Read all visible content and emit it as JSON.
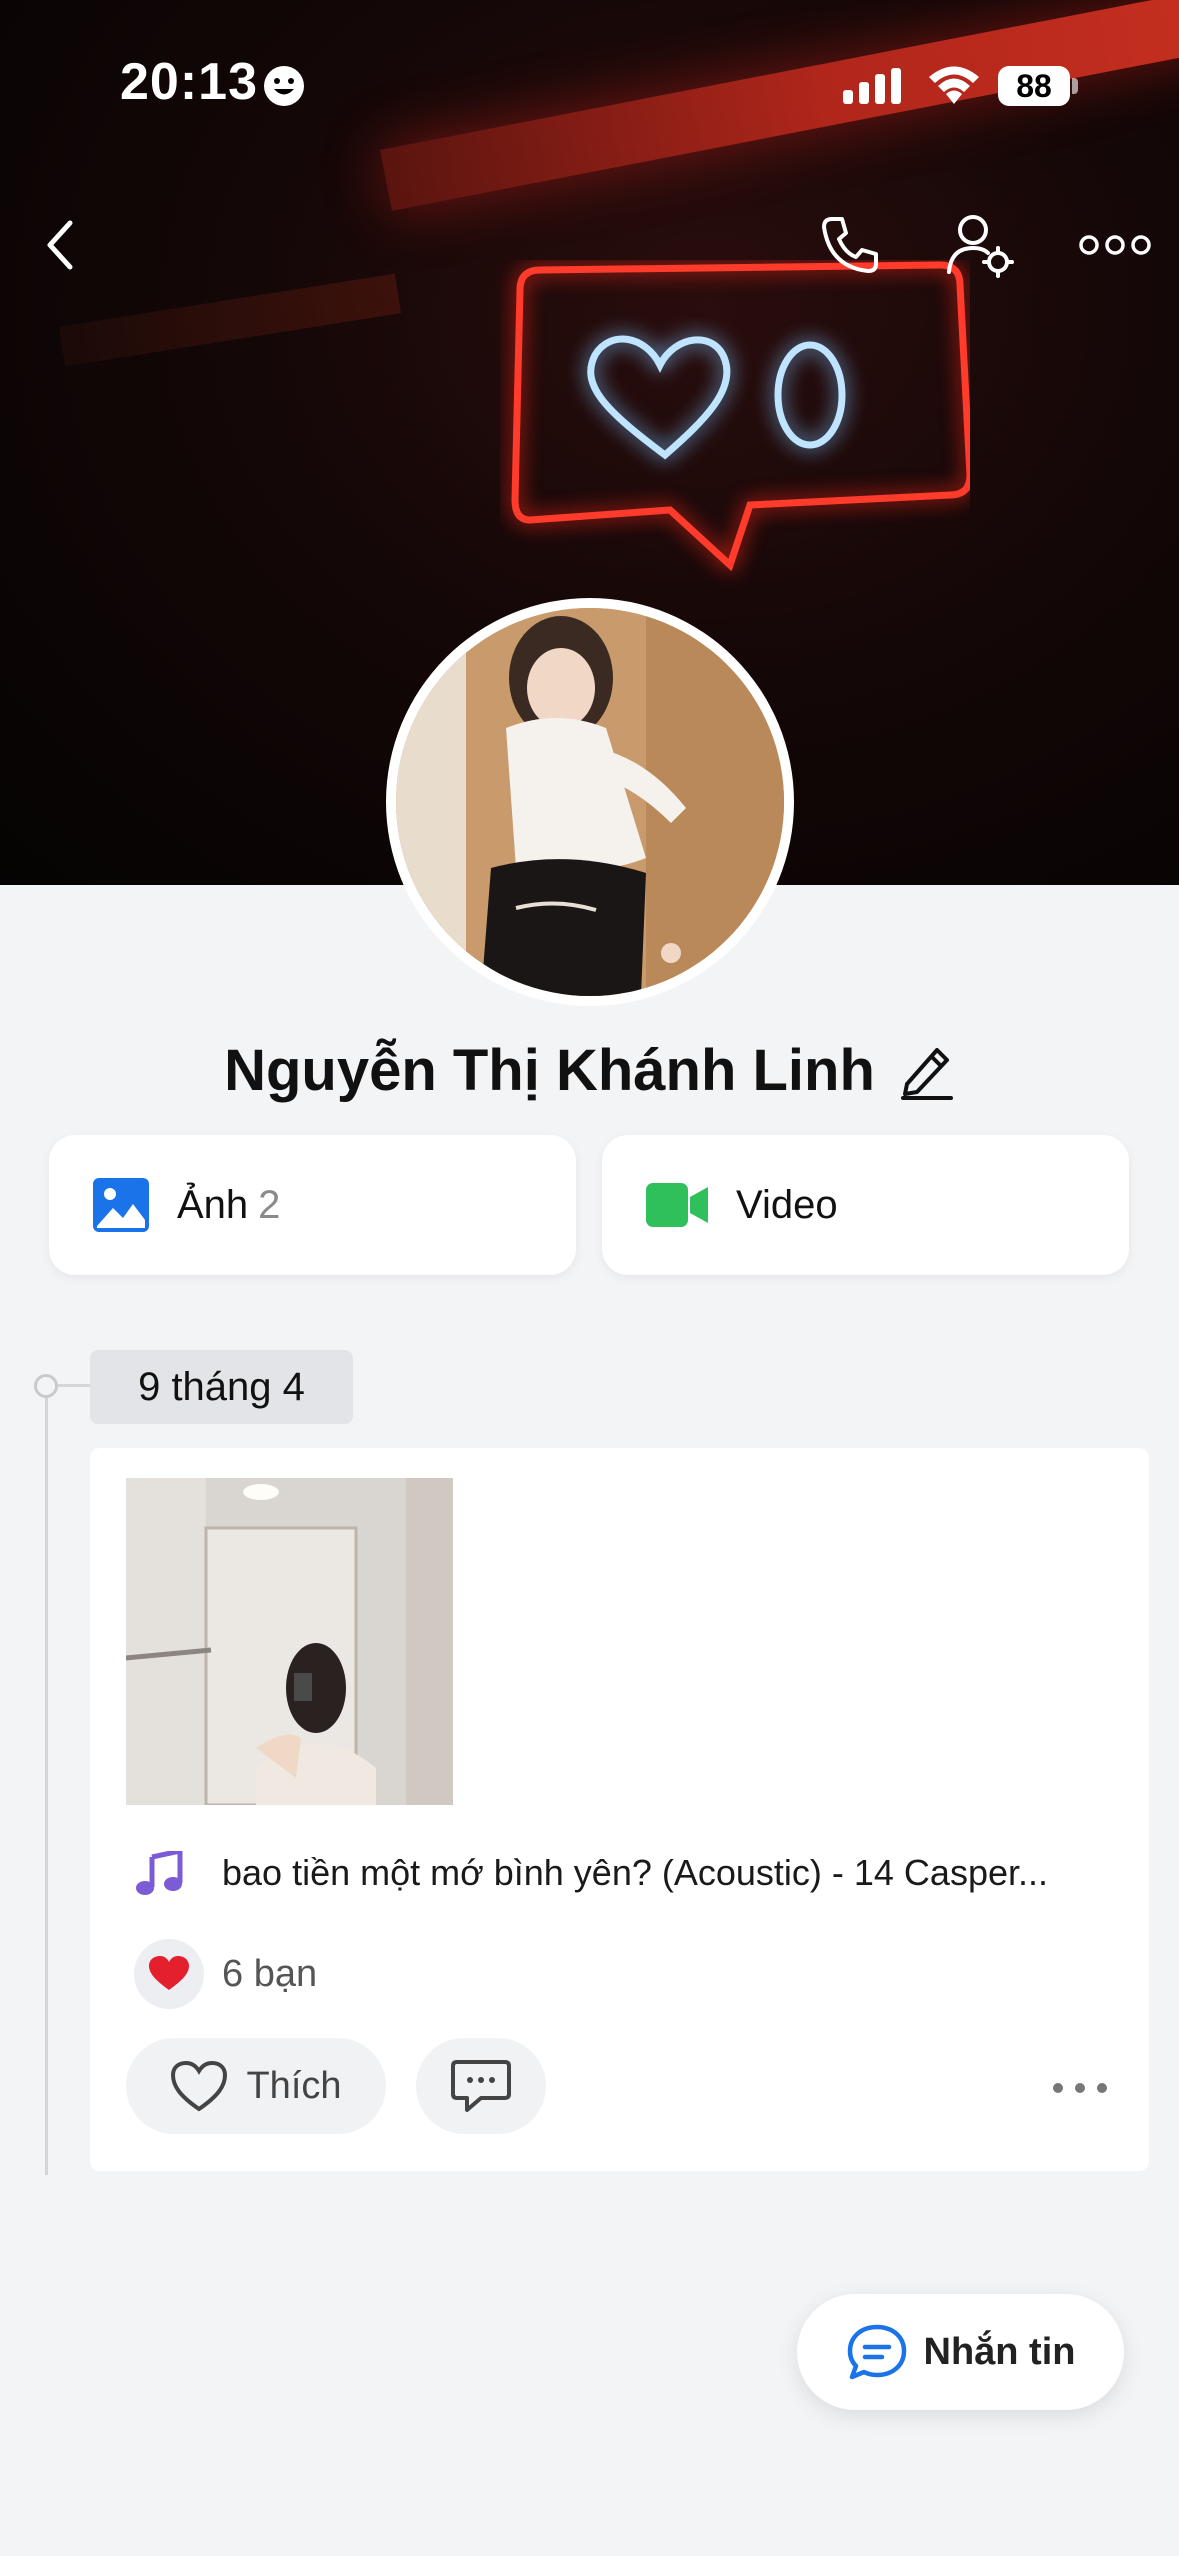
{
  "status_bar": {
    "time": "20:13",
    "battery": "88"
  },
  "header": {
    "back_icon": "chevron-left-icon",
    "call_icon": "phone-icon",
    "settings_icon": "user-settings-icon",
    "more_icon": "more-horizontal-icon"
  },
  "profile": {
    "name": "Nguyễn Thị Khánh Linh",
    "edit_icon": "pencil-icon"
  },
  "media": {
    "photos_label": "Ảnh",
    "photos_count": "2",
    "video_label": "Video",
    "photo_icon_color": "#1a73e8",
    "video_icon_color": "#2fbf5b"
  },
  "timeline": {
    "date": "9 tháng 4"
  },
  "post": {
    "music_text": "bao tiền một mớ bình yên? (Acoustic) - 14 Casper...",
    "music_icon_color": "#7b5cd6",
    "reaction_count": "6 bạn",
    "like_label": "Thích"
  },
  "fab": {
    "message_label": "Nhắn tin",
    "accent": "#1a73e8"
  }
}
